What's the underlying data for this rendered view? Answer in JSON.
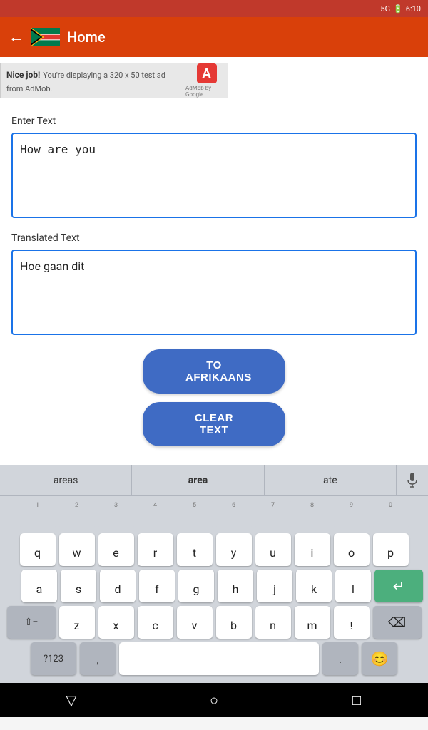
{
  "statusBar": {
    "signal": "5G",
    "battery": "🔋",
    "time": "6:10"
  },
  "navBar": {
    "title": "Home",
    "backIcon": "←"
  },
  "ad": {
    "boldText": "Nice job!",
    "descText": "You're displaying a 320 x 50 test ad from AdMob.",
    "logoText": "A",
    "byText": "AdMob by Google"
  },
  "enterTextLabel": "Enter Text",
  "inputText": "How are you",
  "translatedTextLabel": "Translated Text",
  "translatedText": "Hoe gaan dit",
  "buttons": {
    "translate": "TO AFRIKAANS",
    "clear": "CLEAR TEXT"
  },
  "keyboard": {
    "suggestions": [
      "areas",
      "area",
      "ate"
    ],
    "rows": {
      "numbers": [
        "1",
        "2",
        "3",
        "4",
        "5",
        "6",
        "7",
        "8",
        "9",
        "0"
      ],
      "qwerty": [
        "q",
        "w",
        "e",
        "r",
        "t",
        "y",
        "u",
        "i",
        "o",
        "p"
      ],
      "asdf": [
        "a",
        "s",
        "d",
        "f",
        "g",
        "h",
        "j",
        "k",
        "l"
      ],
      "zxcv": [
        "z",
        "x",
        "c",
        "v",
        "b",
        "n",
        "m"
      ]
    },
    "specialKeys": {
      "shift": "⇧",
      "backspace": "⌫",
      "enter": "↵",
      "numSwitch": "?123",
      "comma": ",",
      "period": ".",
      "emoji": "😊"
    }
  },
  "bottomNav": {
    "back": "▽",
    "home": "○",
    "recent": "□"
  }
}
